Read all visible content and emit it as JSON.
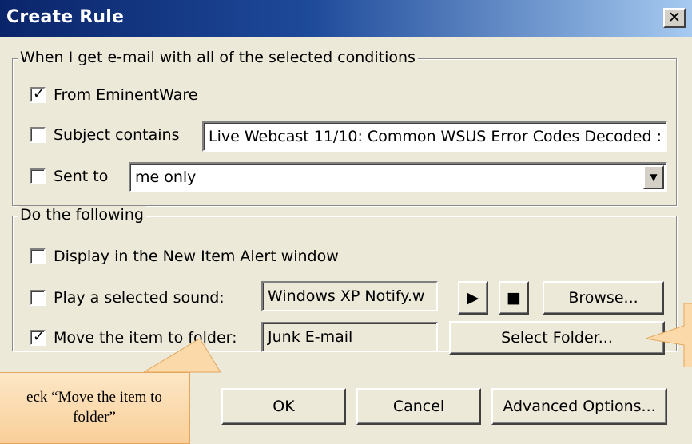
{
  "window": {
    "title": "Create Rule",
    "close_label": "✕"
  },
  "conditions": {
    "legend": "When I get e-mail with all of the selected conditions",
    "from": {
      "label": "From EminentWare",
      "checked": true
    },
    "subject": {
      "label": "Subject contains",
      "checked": false,
      "value": "Live Webcast 11/10: Common WSUS Error Codes Decoded :"
    },
    "sent_to": {
      "label": "Sent to",
      "checked": false,
      "value": "me only"
    }
  },
  "actions": {
    "legend": "Do the following",
    "display_alert": {
      "label": "Display in the New Item Alert window",
      "checked": false
    },
    "play_sound": {
      "label": "Play a selected sound:",
      "checked": false,
      "value": "Windows XP Notify.w",
      "browse_label": "Browse..."
    },
    "move_folder": {
      "label": "Move the item to folder:",
      "checked": true,
      "value": "Junk E-mail",
      "select_label": "Select Folder..."
    }
  },
  "buttons": {
    "ok": "OK",
    "cancel": "Cancel",
    "advanced": "Advanced Options..."
  },
  "callout": {
    "line1": "eck “Move the item to",
    "line2": "folder”"
  },
  "icons": {
    "check": "checkmark-icon",
    "play": "play-icon",
    "stop": "stop-icon",
    "dropdown": "chevron-down-icon"
  }
}
